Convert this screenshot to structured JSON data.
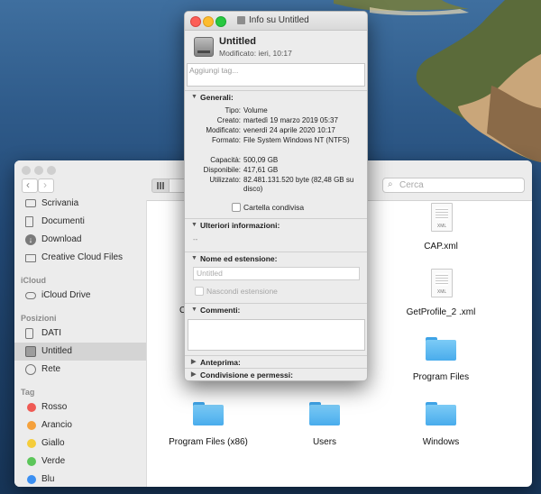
{
  "finder": {
    "search_placeholder": "Cerca",
    "sidebar": {
      "favorites": [
        {
          "label": "Scrivania",
          "icon": "desktop-icon"
        },
        {
          "label": "Documenti",
          "icon": "document-icon"
        },
        {
          "label": "Download",
          "icon": "download-icon"
        },
        {
          "label": "Creative Cloud Files",
          "icon": "folder-icon"
        }
      ],
      "icloud_header": "iCloud",
      "icloud": [
        {
          "label": "iCloud Drive",
          "icon": "cloud-icon"
        }
      ],
      "locations_header": "Posizioni",
      "locations": [
        {
          "label": "DATI",
          "icon": "disk-icon"
        },
        {
          "label": "Untitled",
          "icon": "disk-icon",
          "selected": true
        },
        {
          "label": "Rete",
          "icon": "globe-icon"
        }
      ],
      "tags_header": "Tag",
      "tags": [
        {
          "label": "Rosso",
          "color": "#ef5a54"
        },
        {
          "label": "Arancio",
          "color": "#f5a13c"
        },
        {
          "label": "Giallo",
          "color": "#f5cd3b"
        },
        {
          "label": "Verde",
          "color": "#5cc65a"
        },
        {
          "label": "Blu",
          "color": "#3b8ff2"
        }
      ]
    },
    "files": [
      {
        "name": "CAP.xml",
        "kind": "xml"
      },
      {
        "name": "GetProfile_2 .xml",
        "kind": "xml"
      },
      {
        "name": "Program Files",
        "kind": "folder"
      },
      {
        "name": "Program Files (x86)",
        "kind": "folder"
      },
      {
        "name": "Users",
        "kind": "folder"
      },
      {
        "name": "Windows",
        "kind": "folder"
      },
      {
        "name": "C",
        "kind": "partial"
      }
    ]
  },
  "info": {
    "title": "Info su Untitled",
    "name": "Untitled",
    "modified_short": "Modificato: ieri, 10:17",
    "tags_placeholder": "Aggiungi tag...",
    "general_header": "Generali:",
    "general": [
      {
        "label": "Tipo:",
        "value": "Volume"
      },
      {
        "label": "Creato:",
        "value": "martedì 19 marzo 2019 05:37"
      },
      {
        "label": "Modificato:",
        "value": "venerdì 24 aprile 2020 10:17"
      },
      {
        "label": "Formato:",
        "value": "File System Windows NT (NTFS)"
      },
      {
        "label": "Capacità:",
        "value": "500,09 GB"
      },
      {
        "label": "Disponibile:",
        "value": "417,61 GB"
      },
      {
        "label": "Utilizzato:",
        "value": "82.481.131.520 byte (82,48 GB su disco)"
      }
    ],
    "shared_folder_label": "Cartella condivisa",
    "more_info_header": "Ulteriori informazioni:",
    "more_info_value": "--",
    "name_ext_header": "Nome ed estensione:",
    "name_field_placeholder": "Untitled",
    "hide_ext_label": "Nascondi estensione",
    "comments_header": "Commenti:",
    "preview_header": "Anteprima:",
    "sharing_header": "Condivisione e permessi:"
  }
}
